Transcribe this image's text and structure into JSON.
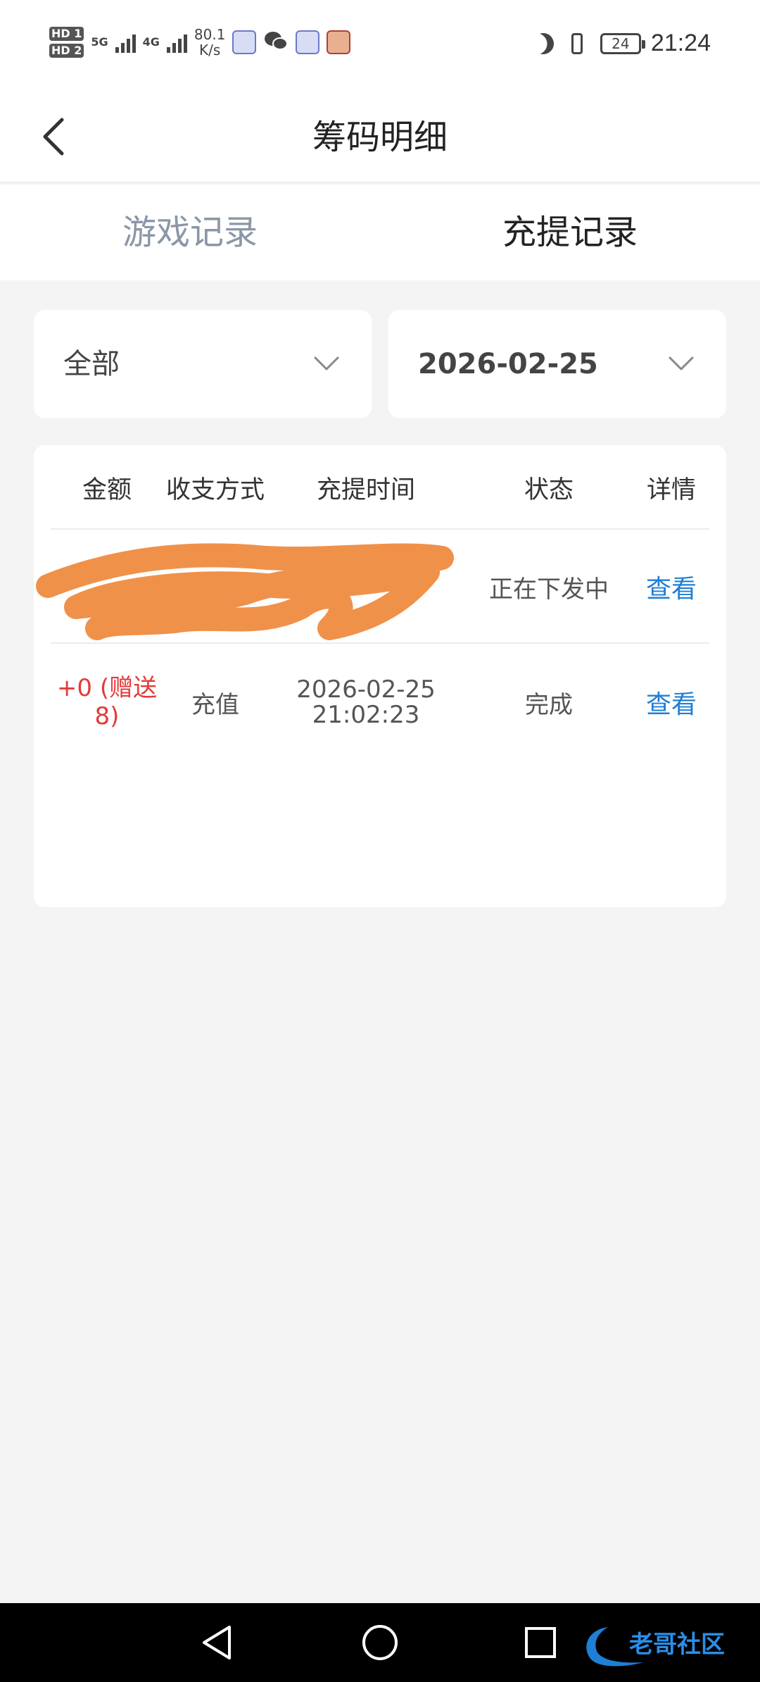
{
  "status_bar": {
    "sim1": "HD 1",
    "sim2": "HD 2",
    "net1": "5G",
    "net2": "4G",
    "speed_value": "80.1",
    "speed_unit": "K/s",
    "battery": "24",
    "time": "21:24"
  },
  "header": {
    "title": "筹码明细"
  },
  "tabs": [
    {
      "label": "游戏记录",
      "active": false
    },
    {
      "label": "充提记录",
      "active": true
    }
  ],
  "filters": {
    "type": "全部",
    "date": "2026-02-25"
  },
  "table": {
    "columns": [
      "金额",
      "收支方式",
      "充提时间",
      "状态",
      "详情"
    ],
    "rows": [
      {
        "amount": "",
        "method": "",
        "time_date": "",
        "time_clock": "",
        "status": "正在下发中",
        "detail": "查看",
        "redacted": true
      },
      {
        "amount_line1": "+0 (赠送",
        "amount_line2": "8)",
        "method": "充值",
        "time_date": "2026-02-25",
        "time_clock": "21:02:23",
        "status": "完成",
        "detail": "查看",
        "redacted": false
      }
    ]
  },
  "watermark": "老哥社区",
  "colors": {
    "link": "#1e7fd6",
    "amount": "#e23b3b",
    "inactive_tab": "#8a97a8",
    "redaction": "#f0914a"
  }
}
